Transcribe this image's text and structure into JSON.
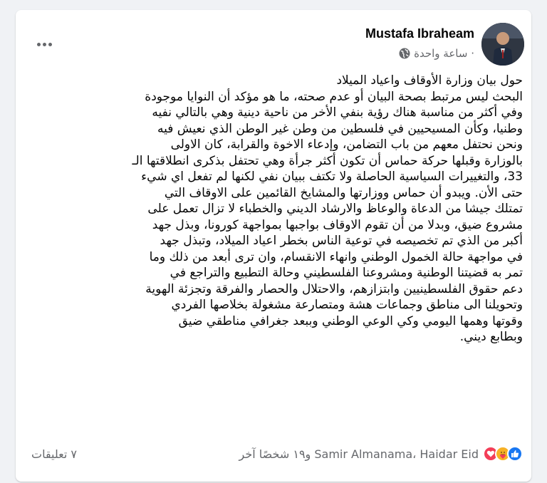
{
  "post": {
    "author": "Mustafa Ibraheam",
    "time": "ساعة واحدة ·",
    "lines": [
      "حول بيان وزارة الأوقاف واعياد الميلاد",
      "البحث ليس مرتبط بصحة البيان أو عدم صحته، ما هو مؤكد أن النوايا موجودة",
      "وفي أكثر من مناسبة هناك رؤية بنفي الأخر من ناحية دينية وهي بالتالي نفيه",
      "وطنيا، وكأن المسيحيين في فلسطين من وطن غير الوطن الذي نعيش فيه",
      "ونحن نحتفل معهم من باب التضامن، وإدعاء الاخوة والقرابة،  كان الاولى",
      "بالوزارة وقبلها حركة حماس أن تكون أكثر جرأة وهي تحتفل بذكرى انطلاقتها الـ",
      "33، والتغييرات السياسية الحاصلة ولا تكتف ببيان نفي لكنها لم تفعل اي شيء",
      "حتى الأن. ويبدو أن حماس ووزارتها والمشايخ القائمين على الاوقاف التي",
      "تمتلك جيشا من الدعاة والوعاظ والارشاد الديني والخطباء لا تزال تعمل على",
      "مشروع ضيق، وبدلا من أن تقوم الاوقاف بواجبها بمواجهة كورونا، وبذل جهد",
      "أكبر من الذي تم تخصيصه في توعية الناس بخطر اعياد الميلاد، وتبذل جهد",
      "في مواجهة حالة الخمول الوطني وانهاء الانقسام، وان ترى أبعد من ذلك وما",
      "تمر به قضيتنا الوطنية ومشروعنا الفلسطيني وحالة التطبيع والتراجع في",
      "دعم حقوق الفلسطينيين وابتزازهم، والاحتلال والحصار والفرقة  وتجزئة الهوية",
      "وتحويلنا الى مناطق وجماعات هشة ومتصارعة مشغولة بخلاصها الفردي",
      "وقوتها وهمها اليومي وكي الوعي الوطني وببعد جغرافي مناطقي ضيق",
      "وبطابع ديني."
    ]
  },
  "footer": {
    "reaction_names": "Samir Almanama، Haidar Eid و١٩ شخصًا آخر",
    "comments": "٧ تعليقات"
  },
  "icons": {
    "globe": "globe-icon",
    "more": "more-options-icon",
    "like": "like-reaction-icon",
    "care": "care-reaction-icon",
    "love": "love-reaction-icon"
  },
  "colors": {
    "like": "#1877f2",
    "love": "#f33e58",
    "care": "#f7b125"
  }
}
